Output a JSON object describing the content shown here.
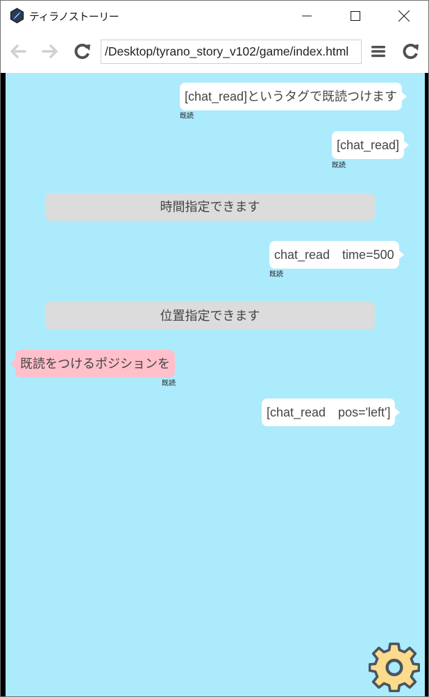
{
  "window": {
    "title": "ティラノストーリー",
    "icon": "tyrano-app-icon",
    "controls": {
      "minimize": "minimize-icon",
      "maximize": "maximize-icon",
      "close": "close-icon"
    }
  },
  "navbar": {
    "url": "/Desktop/tyrano_story_v102/game/index.html",
    "buttons": [
      "back-arrow-icon",
      "forward-arrow-icon",
      "reload-icon",
      "menu-icon",
      "reload-icon"
    ]
  },
  "chat": {
    "background": "#abebfc",
    "messages": [
      {
        "type": "bubble",
        "side": "right",
        "text": "[chat_read]というタグで既読つけます",
        "read": "既読",
        "color": "#ffffff"
      },
      {
        "type": "bubble",
        "side": "right",
        "text": "[chat_read]",
        "read": "既読",
        "color": "#ffffff"
      },
      {
        "type": "system",
        "text": "時間指定できます",
        "color": "#dcdcdc"
      },
      {
        "type": "bubble",
        "side": "right",
        "text": "chat_read　time=500",
        "read": "既読",
        "color": "#ffffff"
      },
      {
        "type": "system",
        "text": "位置指定できます",
        "color": "#dcdcdc"
      },
      {
        "type": "bubble",
        "side": "left",
        "text": "既読をつけるポジションを",
        "read": "既読",
        "color": "#ffc0cb"
      },
      {
        "type": "bubble",
        "side": "right",
        "text": "[chat_read　pos='left']",
        "color": "#ffffff"
      }
    ]
  },
  "settings": {
    "icon": "gear-icon",
    "color": "#fddb8c"
  }
}
